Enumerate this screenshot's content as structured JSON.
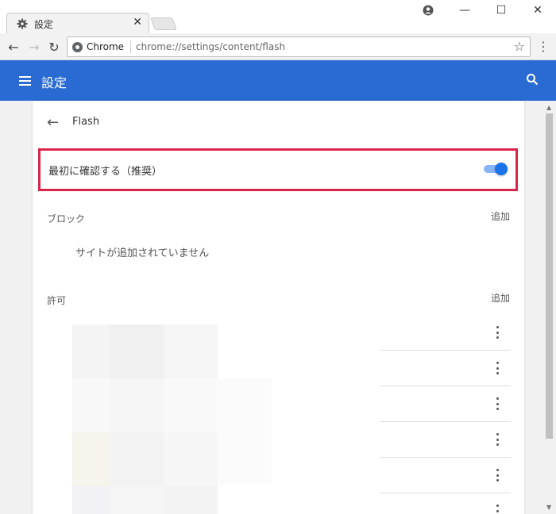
{
  "tab": {
    "title": "設定",
    "close": "✕"
  },
  "window_controls": {
    "minimize": "—",
    "maximize": "☐",
    "close": "✕"
  },
  "toolbar": {
    "back": "←",
    "forward": "→",
    "reload": "↻",
    "origin": "Chrome",
    "url": "chrome://settings/content/flash",
    "bookmark": "☆",
    "menu": "⋮"
  },
  "header": {
    "title": "設定"
  },
  "page": {
    "title": "Flash",
    "ask_first_label": "最初に確認する（推奨）",
    "ask_first_enabled": true,
    "block": {
      "label": "ブロック",
      "add": "追加",
      "empty": "サイトが追加されていません"
    },
    "allow": {
      "label": "許可",
      "add": "追加"
    }
  },
  "colors": {
    "header": "#2a6ad3",
    "highlight": "#d9254a",
    "toggle": "#1a73e8"
  }
}
